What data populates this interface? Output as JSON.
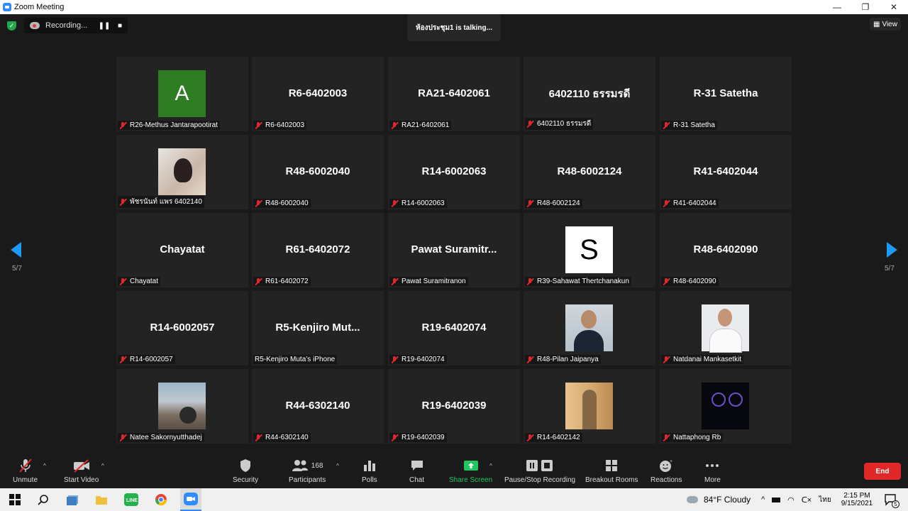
{
  "window": {
    "title": "Zoom Meeting",
    "min": "—",
    "max": "❐",
    "close": "✕"
  },
  "topbar": {
    "recording_label": "Recording...",
    "pause_icon": "❚❚",
    "stop_icon": "■",
    "talking": "ห้องประชุม1 is  talking...",
    "view_label": "View"
  },
  "pagination": {
    "left": "5/7",
    "right": "5/7"
  },
  "tiles": [
    {
      "display": "A",
      "footer": "R26-Methus Jantarapootirat"
    },
    {
      "display": "R6-6402003",
      "footer": "R6-6402003"
    },
    {
      "display": "RA21-6402061",
      "footer": "RA21-6402061"
    },
    {
      "display": "6402110 ธรรมรดี",
      "footer": "6402110 ธรรมรดี"
    },
    {
      "display": "R-31 Satetha",
      "footer": "R-31 Satetha"
    },
    {
      "display": "",
      "footer": "พัชรนันท์ แพร 6402140"
    },
    {
      "display": "R48-6002040",
      "footer": "R48-6002040"
    },
    {
      "display": "R14-6002063",
      "footer": "R14-6002063"
    },
    {
      "display": "R48-6002124",
      "footer": "R48-6002124"
    },
    {
      "display": "R41-6402044",
      "footer": "R41-6402044"
    },
    {
      "display": "Chayatat",
      "footer": "Chayatat"
    },
    {
      "display": "R61-6402072",
      "footer": "R61-6402072"
    },
    {
      "display": "Pawat  Suramitr...",
      "footer": "Pawat Suramitranon"
    },
    {
      "display": "S",
      "footer": "R39-Sahawat Thertchanakun"
    },
    {
      "display": "R48-6402090",
      "footer": "R48-6402090"
    },
    {
      "display": "R14-6002057",
      "footer": "R14-6002057"
    },
    {
      "display": "R5-Kenjiro  Mut...",
      "footer": "R5-Kenjiro Muta’s iPhone"
    },
    {
      "display": "R19-6402074",
      "footer": "R19-6402074"
    },
    {
      "display": "",
      "footer": "R48-Pilan Jaipanya"
    },
    {
      "display": "",
      "footer": "Natdanai Mankasetkit"
    },
    {
      "display": "",
      "footer": "Natee Sakornyutthadej"
    },
    {
      "display": "R44-6302140",
      "footer": "R44-6302140"
    },
    {
      "display": "R19-6402039",
      "footer": "R19-6402039"
    },
    {
      "display": "",
      "footer": "R14-6402142"
    },
    {
      "display": "",
      "footer": "Nattaphong Rb"
    }
  ],
  "toolbar": {
    "unmute": "Unmute",
    "start_video": "Start Video",
    "security": "Security",
    "participants": "Participants",
    "participant_count": "168",
    "polls": "Polls",
    "chat": "Chat",
    "share_screen": "Share Screen",
    "pause_stop_recording": "Pause/Stop Recording",
    "breakout_rooms": "Breakout Rooms",
    "reactions": "Reactions",
    "more": "More",
    "end": "End",
    "caret": "^"
  },
  "taskbar": {
    "weather": "84°F  Cloudy",
    "lang": "ไทย",
    "time": "2:15 PM",
    "date": "9/15/2021",
    "notif_count": "5"
  },
  "colors": {
    "accent": "#2d8cff",
    "end": "#e02828",
    "share": "#22c55e",
    "nav": "#1a9bf5"
  }
}
